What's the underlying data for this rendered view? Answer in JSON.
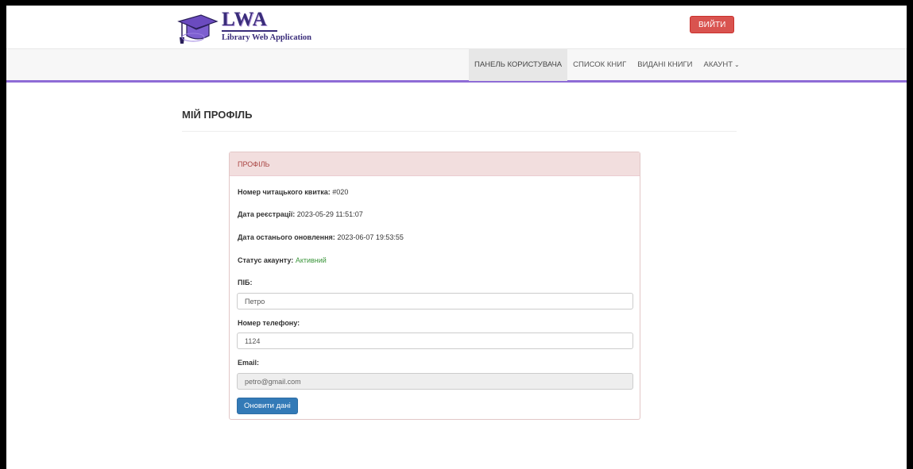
{
  "logo": {
    "title": "LWA",
    "subtitle": "Library Web Application",
    "icon": "graduation-cap-icon"
  },
  "header": {
    "logout_label": "ВИЙТИ"
  },
  "nav": {
    "items": [
      {
        "label": "ПАНЕЛЬ КОРИСТУВАЧА",
        "active": true
      },
      {
        "label": "СПИСОК КНИГ"
      },
      {
        "label": "ВИДАНІ КНИГИ"
      },
      {
        "label": "АКАУНТ",
        "icon": "chevron-down-icon"
      }
    ]
  },
  "page": {
    "title": "МІЙ ПРОФІЛЬ"
  },
  "panel": {
    "heading": "ПРОФІЛЬ",
    "card_label": "Номер читацького квитка:",
    "card_value": "#020",
    "reg_label": "Дата реєстрації:",
    "reg_value": "2023-05-29 11:51:07",
    "update_label": "Дата останього оновлення:",
    "update_value": "2023-06-07 19:53:55",
    "status_label": "Статус акаунту:",
    "status_value": "Активний",
    "name_label": "ПІБ:",
    "name_value": "Петро",
    "phone_label": "Номер телефону:",
    "phone_value": "1124",
    "email_label": "Email:",
    "email_value": "petro@gmail.com",
    "submit_label": "Оновити дані"
  },
  "colors": {
    "accent": "#8e6cd6",
    "danger": "#d9534f",
    "primary": "#337ab7",
    "panel_head": "#f2dede",
    "status_active": "#3c963c"
  }
}
